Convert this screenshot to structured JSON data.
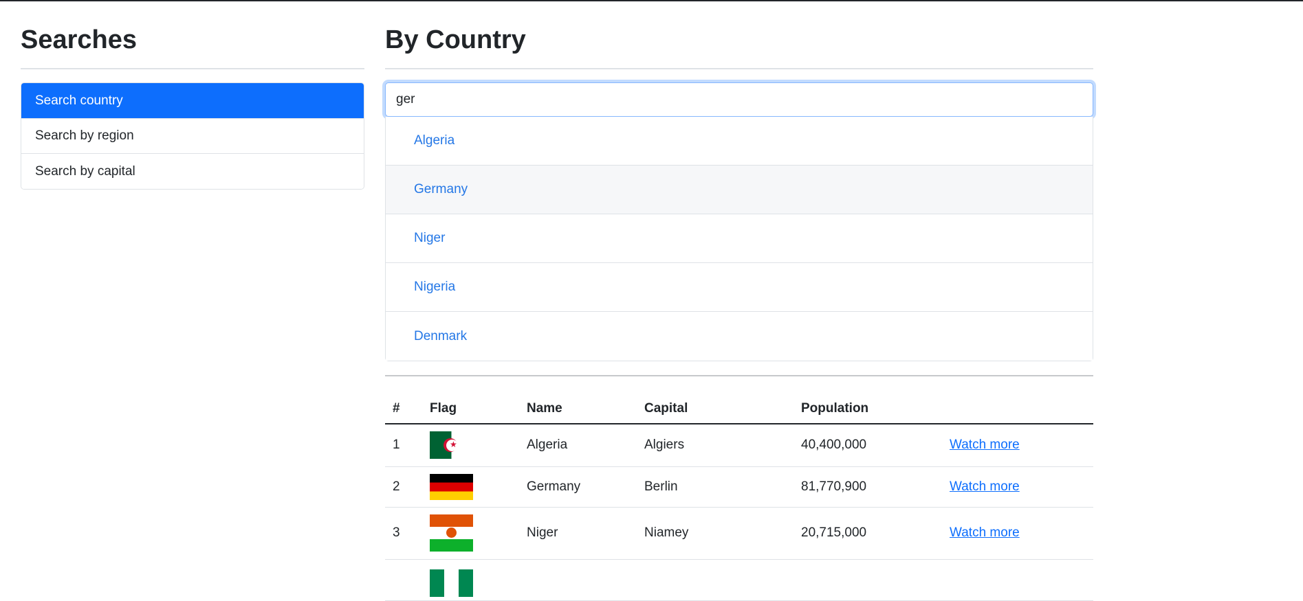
{
  "sidebar": {
    "title": "Searches",
    "items": [
      {
        "label": "Search country",
        "active": true
      },
      {
        "label": "Search by region",
        "active": false
      },
      {
        "label": "Search by capital",
        "active": false
      }
    ]
  },
  "main": {
    "title": "By Country",
    "search": {
      "value": "ger"
    },
    "suggestions": [
      "Algeria",
      "Germany",
      "Niger",
      "Nigeria",
      "Denmark"
    ],
    "table": {
      "headers": [
        "#",
        "Flag",
        "Name",
        "Capital",
        "Population",
        ""
      ],
      "rows": [
        {
          "index": "1",
          "flag": "algeria-flag",
          "name": "Algeria",
          "capital": "Algiers",
          "population": "40,400,000",
          "link": "Watch more"
        },
        {
          "index": "2",
          "flag": "germany-flag",
          "name": "Germany",
          "capital": "Berlin",
          "population": "81,770,900",
          "link": "Watch more"
        },
        {
          "index": "3",
          "flag": "niger-flag",
          "name": "Niger",
          "capital": "Niamey",
          "population": "20,715,000",
          "link": "Watch more"
        },
        {
          "index": "",
          "flag": "nigeria-flag",
          "name": "",
          "capital": "",
          "population": "",
          "link": ""
        }
      ]
    }
  },
  "colors": {
    "accent": "#0d6efd",
    "suggestion_text": "#2477e6"
  }
}
